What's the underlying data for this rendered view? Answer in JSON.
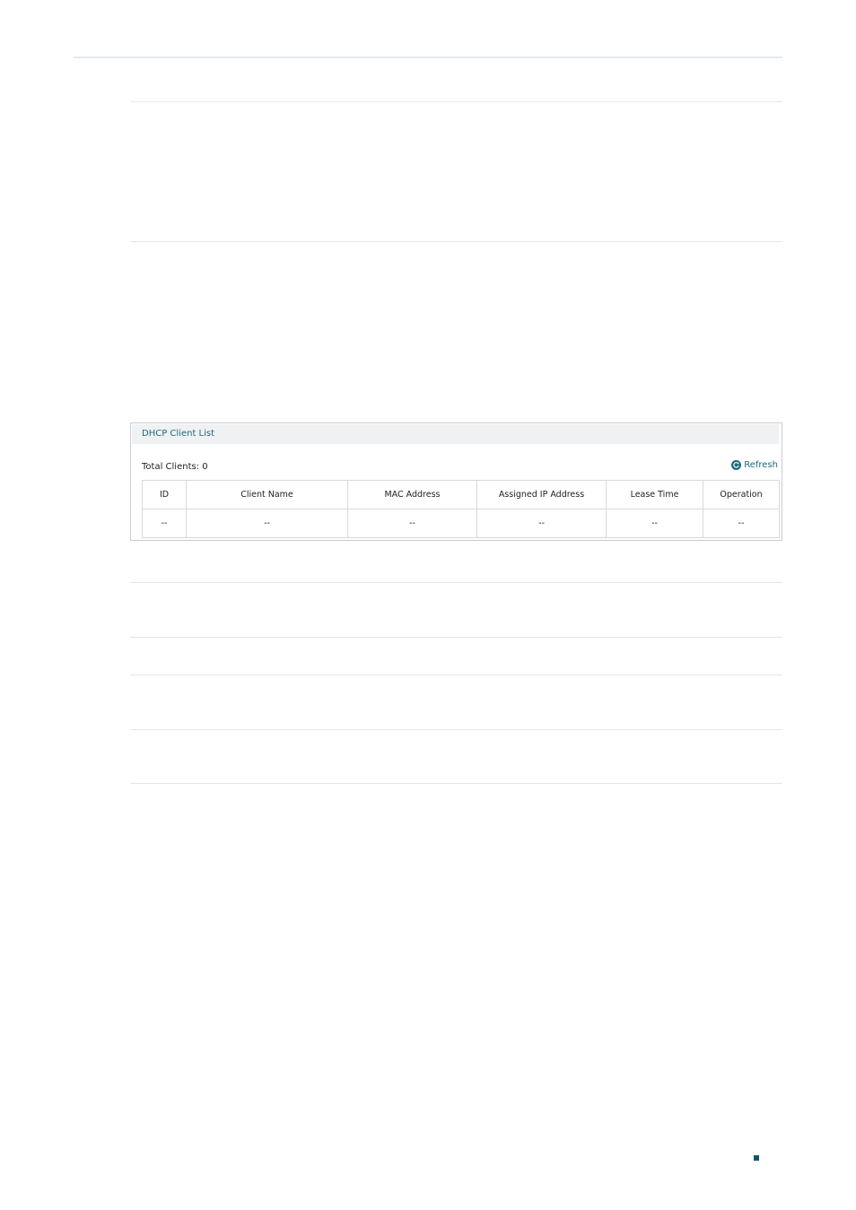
{
  "panel": {
    "title": "DHCP Client List",
    "total_clients_label": "Total Clients: 0",
    "refresh_label": "Refresh"
  },
  "table": {
    "headers": [
      "ID",
      "Client Name",
      "MAC Address",
      "Assigned IP Address",
      "Lease Time",
      "Operation"
    ],
    "rows": [
      [
        "--",
        "--",
        "--",
        "--",
        "--",
        "--"
      ]
    ]
  },
  "colors": {
    "accent": "#1c6a82",
    "page_marker": "#00566c"
  },
  "icons": {
    "refresh": "refresh-icon"
  }
}
